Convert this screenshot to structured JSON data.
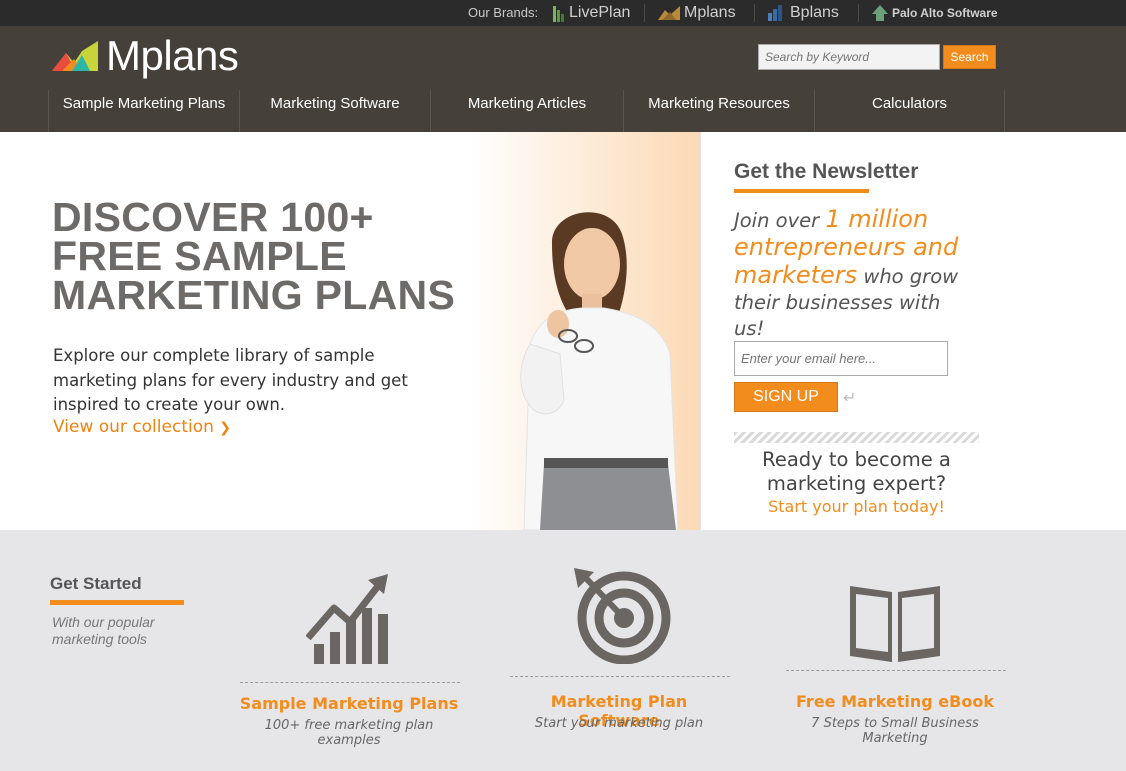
{
  "brands_bar": {
    "label": "Our Brands:",
    "brands": [
      {
        "name": "LivePlan",
        "icon": "liveplan-logo-icon"
      },
      {
        "name": "Mplans",
        "icon": "mplans-logo-icon"
      },
      {
        "name": "Bplans",
        "icon": "bplans-logo-icon"
      },
      {
        "name": "Palo Alto Software",
        "icon": "palo-alto-logo-icon"
      }
    ]
  },
  "header": {
    "logo_text": "Mplans",
    "search_placeholder": "Search by Keyword",
    "search_button": "Search",
    "nav": [
      {
        "label": "Sample Marketing Plans"
      },
      {
        "label": "Marketing Software"
      },
      {
        "label": "Marketing Articles"
      },
      {
        "label": "Marketing Resources"
      },
      {
        "label": "Calculators"
      }
    ]
  },
  "hero": {
    "title": "DISCOVER 100+ FREE SAMPLE MARKETING PLANS",
    "text": "Explore our complete library of sample marketing plans for every industry and get inspired to create your own.",
    "link": "View our collection"
  },
  "newsletter": {
    "title": "Get the Newsletter",
    "copy_prefix": "Join over ",
    "copy_highlight": "1 million entrepreneurs and marketers",
    "copy_suffix": " who grow their businesses with us!",
    "email_placeholder": "Enter your email here...",
    "signup_button": "SIGN UP",
    "cta_text": "Ready to become a marketing expert?",
    "cta_link": "Start your plan today!"
  },
  "get_started": {
    "title": "Get Started",
    "subtitle": "With our popular marketing tools",
    "tools": [
      {
        "title": "Sample Marketing Plans",
        "subtitle": "100+ free marketing plan examples",
        "icon": "bar-chart-trend-icon"
      },
      {
        "title": "Marketing Plan Software",
        "subtitle": "Start your marketing plan",
        "icon": "target-icon"
      },
      {
        "title": "Free Marketing eBook",
        "subtitle": "7 Steps to Small Business Marketing",
        "icon": "open-book-icon"
      }
    ]
  },
  "colors": {
    "accent": "#f28c1c",
    "header_bg": "#46403b",
    "brands_bg": "#2b2b2b",
    "bottom_bg": "#e6e6e8"
  }
}
